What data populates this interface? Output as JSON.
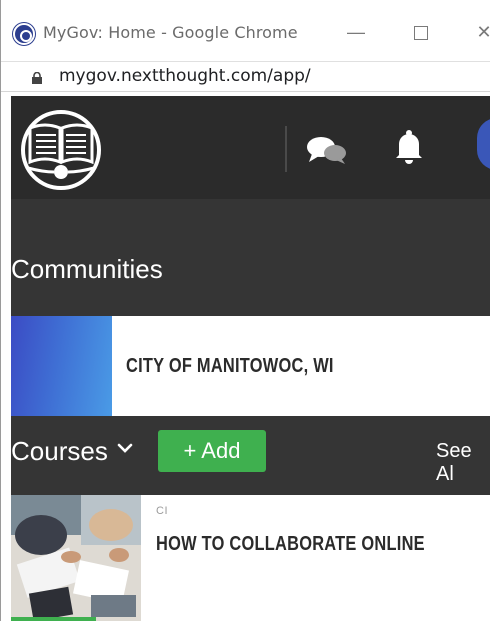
{
  "window": {
    "title": "MyGov: Home - Google Chrome",
    "url": "mygov.nextthought.com/app/",
    "minimize_glyph": "—",
    "close_glyph": "✕"
  },
  "header": {
    "logo": "book-seal-logo",
    "icons": [
      "chat-icon",
      "bell-icon"
    ],
    "avatar_color": "#3a57b8"
  },
  "communities": {
    "title": "Communities",
    "items": [
      {
        "name": "CITY OF MANITOWOC, WI"
      }
    ]
  },
  "courses": {
    "title": "Courses",
    "add_label": "+ Add",
    "see_all_label": "See Al",
    "items": [
      {
        "code": "CI",
        "title": "HOW TO COLLABORATE ONLINE"
      }
    ]
  },
  "colors": {
    "header_bg": "#2b2b2b",
    "main_bg": "#353535",
    "accent_green": "#3fb04f",
    "community_blue": "#3f6fd4"
  }
}
